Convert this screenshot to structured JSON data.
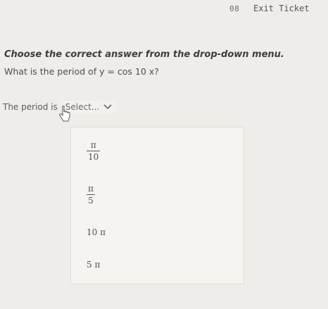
{
  "header": {
    "code": "08",
    "title": "Exit Ticket"
  },
  "prompt": {
    "instruction": "Choose the correct answer from the drop-down menu.",
    "question": "What is the period of y = cos 10 x?"
  },
  "answer": {
    "label": "The period is",
    "select_placeholder": "Select..."
  },
  "dropdown": {
    "options": [
      {
        "type": "fraction",
        "numerator": "π",
        "denominator": "10"
      },
      {
        "type": "fraction",
        "numerator": "π",
        "denominator": "5"
      },
      {
        "type": "text",
        "label": "10 π"
      },
      {
        "type": "text",
        "label": "5 π"
      }
    ]
  },
  "icons": {
    "select_chevron": "chevron-down-icon",
    "pointer": "hand-pointer-icon"
  }
}
